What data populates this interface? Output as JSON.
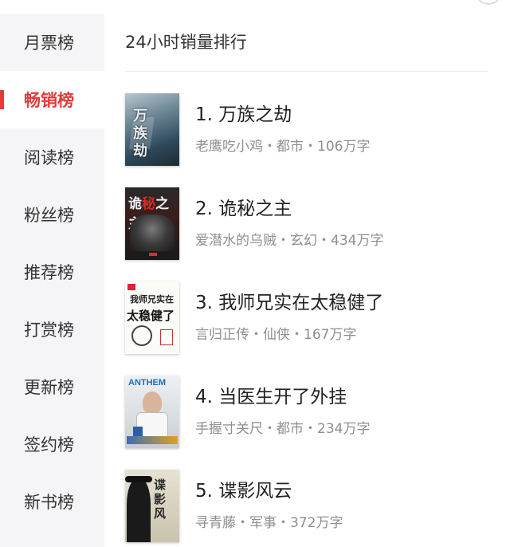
{
  "sidebar": {
    "items": [
      {
        "label": "月票榜"
      },
      {
        "label": "畅销榜"
      },
      {
        "label": "阅读榜"
      },
      {
        "label": "粉丝榜"
      },
      {
        "label": "推荐榜"
      },
      {
        "label": "打赏榜"
      },
      {
        "label": "更新榜"
      },
      {
        "label": "签约榜"
      },
      {
        "label": "新书榜"
      }
    ]
  },
  "main": {
    "title": "24小时销量排行",
    "books": [
      {
        "title": "1. 万族之劫",
        "meta": "老鹰吃小鸡・都市・106万字",
        "cover_text": "万族之劫"
      },
      {
        "title": "2. 诡秘之主",
        "meta": "爱潜水的乌贼・玄幻・434万字",
        "cover_text": "诡秘之主"
      },
      {
        "title": "3. 我师兄实在太稳健了",
        "meta": "言归正传・仙侠・167万字",
        "cover_text": "我师兄实在太稳健了"
      },
      {
        "title": "4. 当医生开了外挂",
        "meta": "手握寸关尺・都市・234万字",
        "cover_text": "ANTHEM"
      },
      {
        "title": "5. 谍影风云",
        "meta": "寻青藤・军事・372万字",
        "cover_text": "谍影风云"
      }
    ]
  },
  "colors": {
    "accent": "#e23c3c",
    "sidebar_bg": "#f5f5f7",
    "meta_text": "#8e8e93"
  }
}
